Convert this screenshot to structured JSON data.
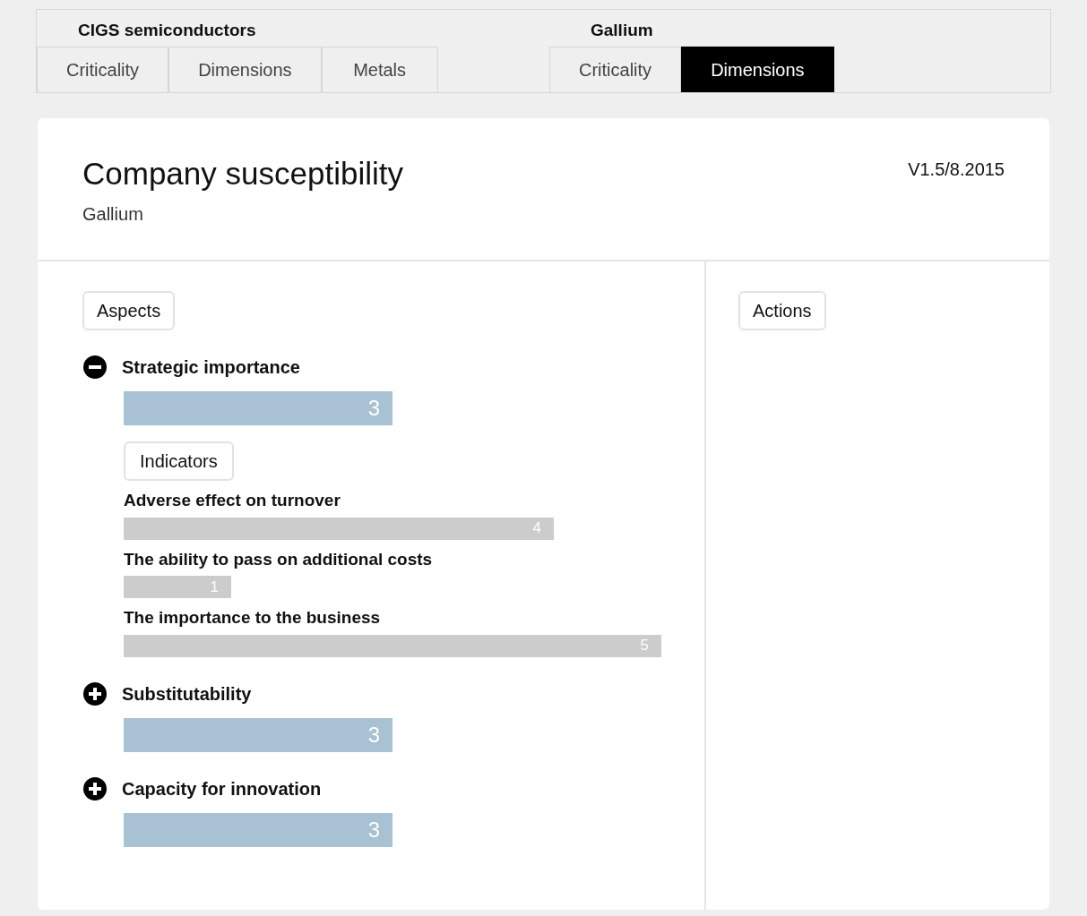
{
  "tab_groups": [
    {
      "title": "CIGS semiconductors",
      "tabs": [
        {
          "label": "Criticality",
          "selected": false
        },
        {
          "label": "Dimensions",
          "selected": false
        },
        {
          "label": "Metals",
          "selected": false
        }
      ]
    },
    {
      "title": "Gallium",
      "tabs": [
        {
          "label": "Criticality",
          "selected": false
        },
        {
          "label": "Dimensions",
          "selected": true
        }
      ]
    }
  ],
  "card": {
    "title": "Company susceptibility",
    "subtitle": "Gallium",
    "version": "V1.5/8.2015"
  },
  "aspects": {
    "label": "Aspects",
    "items": [
      {
        "name": "Strategic importance",
        "expanded": true,
        "value": "3",
        "indicators_label": "Indicators",
        "indicators": [
          {
            "name": "Adverse effect on turnover",
            "value": "4"
          },
          {
            "name": "The ability to pass on additional costs",
            "value": "1"
          },
          {
            "name": "The importance to the business",
            "value": "5"
          }
        ]
      },
      {
        "name": "Substitutability",
        "expanded": false,
        "value": "3"
      },
      {
        "name": "Capacity for innovation",
        "expanded": false,
        "value": "3"
      }
    ]
  },
  "actions": {
    "label": "Actions"
  }
}
